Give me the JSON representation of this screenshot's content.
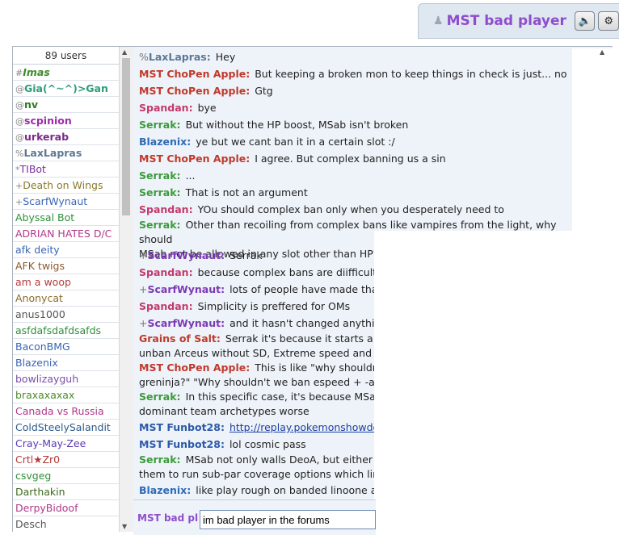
{
  "header": {
    "username": "MST bad player",
    "sound_icon": "speaker-icon",
    "settings_icon": "gear-icon"
  },
  "userlist": {
    "count_label": "89 users",
    "users": [
      {
        "rank": "#",
        "name": "Imas",
        "color": "#3d8b2b",
        "style": "bold-italic"
      },
      {
        "rank": "@",
        "name": "Gia(^~^)>Gan",
        "color": "#2d9c7a",
        "style": "bold"
      },
      {
        "rank": "@",
        "name": "nv",
        "color": "#2f7d1f",
        "style": "bold"
      },
      {
        "rank": "@",
        "name": "scpinion",
        "color": "#9a2ca8",
        "style": "bold"
      },
      {
        "rank": "@",
        "name": "urkerab",
        "color": "#7b2b8b",
        "style": "bold"
      },
      {
        "rank": "%",
        "name": "LaxLapras",
        "color": "#5d7896",
        "style": "bold"
      },
      {
        "rank": "*",
        "name": "TIBot",
        "color": "#7d2ba0",
        "style": "normal"
      },
      {
        "rank": "+",
        "name": "Death on Wings",
        "color": "#8a7a2a",
        "style": "normal"
      },
      {
        "rank": "+",
        "name": "ScarfWynaut",
        "color": "#3a66b5",
        "style": "normal"
      },
      {
        "rank": "",
        "name": "Abyssal Bot",
        "color": "#2f8f3a",
        "style": "normal"
      },
      {
        "rank": "",
        "name": "ADRIAN HATES D/C",
        "color": "#b0398a",
        "style": "normal"
      },
      {
        "rank": "",
        "name": "afk deity",
        "color": "#3a66b5",
        "style": "normal"
      },
      {
        "rank": "",
        "name": "AFK twigs",
        "color": "#8b5a2b",
        "style": "normal"
      },
      {
        "rank": "",
        "name": "am a woop",
        "color": "#b53a3a",
        "style": "normal"
      },
      {
        "rank": "",
        "name": "Anonycat",
        "color": "#8b6b2b",
        "style": "normal"
      },
      {
        "rank": "",
        "name": "anus1000",
        "color": "#555555",
        "style": "normal"
      },
      {
        "rank": "",
        "name": "asfdafsdafdsafds",
        "color": "#2f8f3a",
        "style": "normal"
      },
      {
        "rank": "",
        "name": "BaconBMG",
        "color": "#3a66b5",
        "style": "normal"
      },
      {
        "rank": "",
        "name": "Blazenix",
        "color": "#3a66b5",
        "style": "normal"
      },
      {
        "rank": "",
        "name": "bowlizayguh",
        "color": "#7b4ea8",
        "style": "normal"
      },
      {
        "rank": "",
        "name": "braxaxaxax",
        "color": "#4a8a2b",
        "style": "normal"
      },
      {
        "rank": "",
        "name": "Canada vs Russia",
        "color": "#b0398a",
        "style": "normal"
      },
      {
        "rank": "",
        "name": "ColdSteelySalandit",
        "color": "#2d5a8a",
        "style": "normal"
      },
      {
        "rank": "",
        "name": "Cray-May-Zee",
        "color": "#5a3ab5",
        "style": "normal"
      },
      {
        "rank": "",
        "name": "Crtl★Zr0",
        "color": "#b53a3a",
        "style": "normal"
      },
      {
        "rank": "",
        "name": "csvgeg",
        "color": "#2f8f3a",
        "style": "normal"
      },
      {
        "rank": "",
        "name": "Darthakin",
        "color": "#3d6a1f",
        "style": "normal"
      },
      {
        "rank": "",
        "name": "DerpyBidoof",
        "color": "#b0398a",
        "style": "normal"
      },
      {
        "rank": "",
        "name": "Desch",
        "color": "#555555",
        "style": "normal"
      }
    ]
  },
  "chat": {
    "messages": [
      {
        "rank": "%",
        "name": "LaxLapras:",
        "color": "#5d7896",
        "text": "Hey"
      },
      {
        "rank": "",
        "name": "MST ChoPen Apple:",
        "color": "#c0392b",
        "text": "But keeping a broken mon to keep things in check is just... no"
      },
      {
        "rank": "",
        "name": "MST ChoPen Apple:",
        "color": "#c0392b",
        "text": "Gtg"
      },
      {
        "rank": "",
        "name": "Spandan:",
        "color": "#c23a6b",
        "text": "bye"
      },
      {
        "rank": "",
        "name": "Serrak:",
        "color": "#3c9a3c",
        "text": "But without the HP boost, MSab isn't broken"
      },
      {
        "rank": "",
        "name": "Blazenix:",
        "color": "#2d6ab5",
        "text": "ye but we cant ban it in a certain slot :/"
      },
      {
        "rank": "",
        "name": "MST ChoPen Apple:",
        "color": "#c0392b",
        "text": "I agree. But complex banning us a sin"
      },
      {
        "rank": "",
        "name": "Serrak:",
        "color": "#3c9a3c",
        "text": "..."
      },
      {
        "rank": "",
        "name": "Serrak:",
        "color": "#3c9a3c",
        "text": "That is not an argument"
      },
      {
        "rank": "",
        "name": "Spandan:",
        "color": "#c23a6b",
        "text": "YOu should complex ban only when you desperately need to"
      },
      {
        "rank": "",
        "name": "Serrak:",
        "color": "#3c9a3c",
        "text": "Other than recoiling from complex bans like vampires from the light, why should",
        "text2": "MSab not be allowed in any slot other than HP?"
      },
      {
        "rank": "+",
        "name": "ScarfWynaut:",
        "color": "#7b3ab5",
        "text": "Serrak"
      },
      {
        "rank": "",
        "name": "Spandan:",
        "color": "#c23a6b",
        "text": "because complex bans are diifficult to"
      },
      {
        "rank": "+",
        "name": "ScarfWynaut:",
        "color": "#7b3ab5",
        "text": "lots of people have made that"
      },
      {
        "rank": "",
        "name": "Spandan:",
        "color": "#c23a6b",
        "text": "Simplicity is preffered for OMs"
      },
      {
        "rank": "+",
        "name": "ScarfWynaut:",
        "color": "#7b3ab5",
        "text": "and it hasn't changed anything"
      },
      {
        "rank": "",
        "name": "Grains of Salt:",
        "color": "#c0392b",
        "text": "Serrak it's because it starts a sl",
        "text2": "unban Arceus without SD, Extreme speed and re"
      },
      {
        "rank": "",
        "name": "MST ChoPen Apple:",
        "color": "#c0392b",
        "text": "This is like \"why shouldn'",
        "text2": "greninja?\" \"Why shouldn't we ban espeed + -ate"
      },
      {
        "rank": "",
        "name": "Serrak:",
        "color": "#3c9a3c",
        "text": "In this specific case, it's because MSab",
        "text2": "dominant team archetypes worse"
      },
      {
        "rank": "",
        "name": "MST Funbot28:",
        "color": "#2d5aa8",
        "text": "http://replay.pokemonshowdo",
        "link": true
      },
      {
        "rank": "",
        "name": "MST Funbot28:",
        "color": "#2d5aa8",
        "text": "lol cosmic pass"
      },
      {
        "rank": "",
        "name": "Serrak:",
        "color": "#3c9a3c",
        "text": "MSab not only walls DeoA, but either w",
        "text2": "them to run sub-par coverage options which limi"
      },
      {
        "rank": "",
        "name": "Blazenix:",
        "color": "#2d6ab5",
        "text": "like play rough on banded linoone and"
      }
    ]
  },
  "input": {
    "me_label": "MST bad pla",
    "value": "im bad player in the forums"
  }
}
